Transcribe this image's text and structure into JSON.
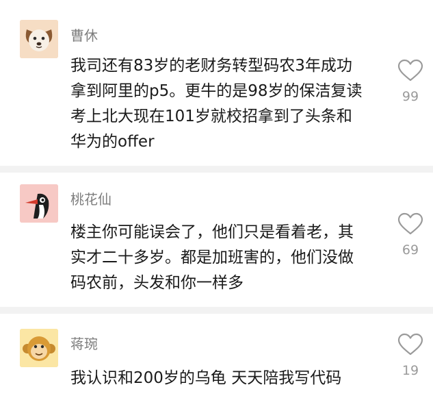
{
  "comments": [
    {
      "username": "曹休",
      "avatar": "dog-avatar-icon",
      "lines": [
        "我司还有83岁的老财务转型码农3年成功",
        "拿到阿里的p5。更牛的是98岁的保洁复读",
        "考上北大现在101岁就校招拿到了头条和",
        "华为的offer"
      ],
      "likes": "99"
    },
    {
      "username": "桃花仙",
      "avatar": "woodpecker-avatar-icon",
      "lines": [
        "楼主你可能误会了，他们只是看着老，其",
        "实才二十多岁。都是加班害的，他们没做",
        "码农前，头发和你一样多"
      ],
      "likes": "69"
    },
    {
      "username": "蒋琬",
      "avatar": "monkey-avatar-icon",
      "lines": [
        "我认识和200岁的乌龟 天天陪我写代码"
      ],
      "likes": "19"
    }
  ],
  "icons": {
    "like": "heart-outline-icon"
  },
  "colors": {
    "username": "#7d7d7d",
    "text": "#1a1a1a",
    "count": "#9a9a9a",
    "divider": "#f2f2f2"
  }
}
